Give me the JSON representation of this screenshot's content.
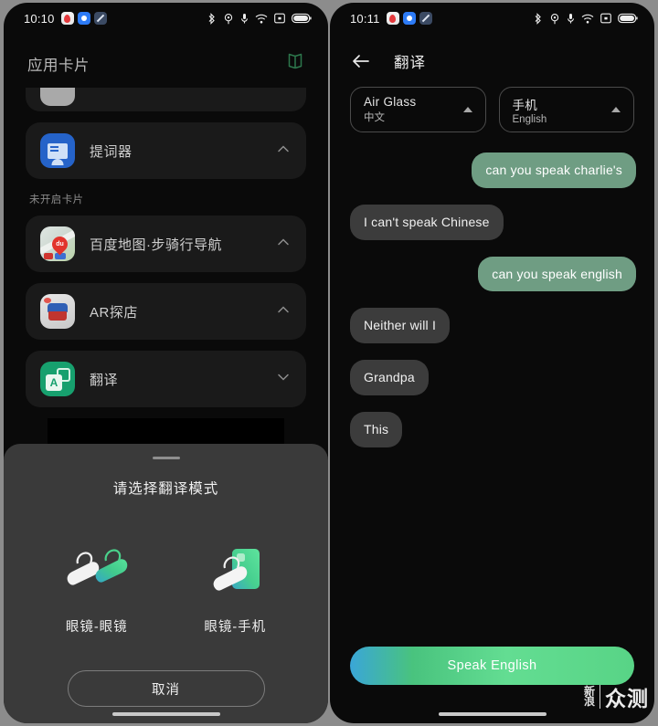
{
  "left": {
    "statusbar": {
      "time": "10:10",
      "app_icons": [
        "map-notification-icon",
        "camera-notification-icon",
        "edit-notification-icon"
      ],
      "system_icons": [
        "bluetooth-icon",
        "location-icon",
        "microphone-icon",
        "wifi-icon",
        "cast-icon",
        "battery-icon"
      ]
    },
    "header": {
      "title": "应用卡片",
      "action_icon": "book-icon"
    },
    "cards": [
      {
        "label": "",
        "icon": "clipped-card-icon",
        "chevron": "none",
        "clipped": true
      },
      {
        "label": "提词器",
        "icon": "teleprompter-icon",
        "chevron": "up"
      }
    ],
    "section_label": "未开启卡片",
    "disabled_cards": [
      {
        "label": "百度地图·步骑行导航",
        "icon": "baidu-map-icon",
        "chevron": "up",
        "pin_text": "du"
      },
      {
        "label": "AR探店",
        "icon": "ar-shop-icon",
        "chevron": "up"
      },
      {
        "label": "翻译",
        "icon": "translate-icon",
        "chevron": "down",
        "glyph": "A"
      }
    ],
    "sheet": {
      "title": "请选择翻译模式",
      "modes": [
        {
          "label": "眼镜-眼镜",
          "icon": "glasses-to-glasses-icon"
        },
        {
          "label": "眼镜-手机",
          "icon": "glasses-to-phone-icon"
        }
      ],
      "cancel_label": "取消"
    }
  },
  "right": {
    "statusbar": {
      "time": "10:11",
      "app_icons": [
        "map-notification-icon",
        "camera-notification-icon",
        "edit-notification-icon"
      ],
      "system_icons": [
        "bluetooth-icon",
        "location-icon",
        "microphone-icon",
        "wifi-icon",
        "cast-icon",
        "battery-icon"
      ]
    },
    "header": {
      "back_icon": "back-arrow-icon",
      "title": "翻译"
    },
    "selectors": [
      {
        "device": "Air Glass",
        "language": "中文",
        "caret": "caret-up-icon"
      },
      {
        "device": "手机",
        "language": "English",
        "caret": "caret-up-icon"
      }
    ],
    "messages": [
      {
        "text": "can you speak charlie's",
        "side": "right",
        "style": "green"
      },
      {
        "text": "I can't speak Chinese",
        "side": "left",
        "style": "grey"
      },
      {
        "text": "can you speak english",
        "side": "right",
        "style": "green"
      },
      {
        "text": "Neither will I",
        "side": "left",
        "style": "grey"
      },
      {
        "text": "Grandpa",
        "side": "left",
        "style": "grey"
      },
      {
        "text": "This",
        "side": "left",
        "style": "grey"
      }
    ],
    "speak_button": "Speak English",
    "watermark": {
      "small": [
        "新",
        "浪"
      ],
      "big": "众测"
    }
  },
  "colors": {
    "bubble_green": "#6f9d83",
    "bubble_grey": "#3c3c3c",
    "sheet_bg": "#3a3a3a",
    "card_bg": "#1a1a1a",
    "accent_green": "#49c37e"
  }
}
